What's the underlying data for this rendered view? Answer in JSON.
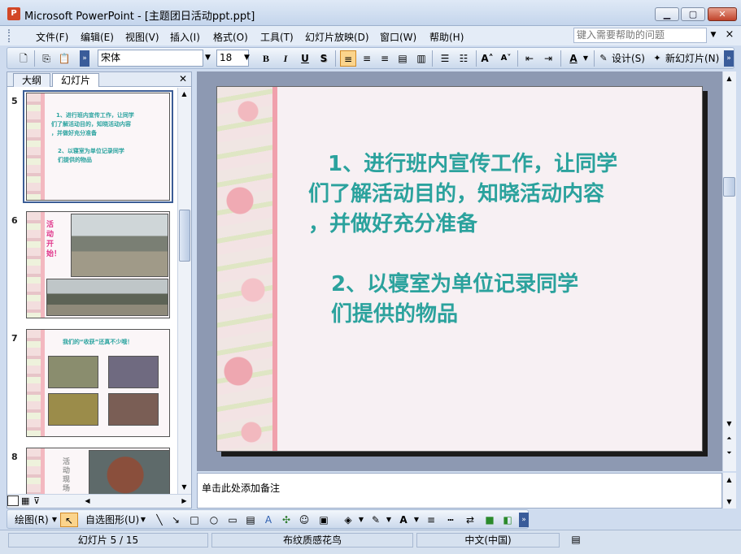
{
  "window": {
    "title": "Microsoft PowerPoint - [主题团日活动ppt.ppt]",
    "app_icon": "powerpoint-icon",
    "controls": {
      "minimize": "minimize-icon",
      "maximize": "maximize-icon",
      "close": "close-icon"
    }
  },
  "menu": {
    "items": [
      "文件(F)",
      "编辑(E)",
      "视图(V)",
      "插入(I)",
      "格式(O)",
      "工具(T)",
      "幻灯片放映(D)",
      "窗口(W)",
      "帮助(H)"
    ],
    "help_placeholder": "键入需要帮助的问题"
  },
  "toolbar": {
    "font": "宋体",
    "font_size": "18",
    "bold": "B",
    "italic": "I",
    "underline": "U",
    "shadow": "S",
    "design_label": "设计(S)",
    "new_slide_label": "新幻灯片(N)",
    "accent_color": "#fbd48c"
  },
  "left_pane": {
    "tabs": [
      "大纲",
      "幻灯片"
    ],
    "active_tab": "幻灯片",
    "slides": [
      {
        "number": "5",
        "text": [
          "1、进行班内宣传工作，让同学",
          "们了解活动目的，知晓活动内容",
          "，并做好充分准备",
          "2、以寝室为单位记录同学",
          "们提供的物品"
        ]
      },
      {
        "number": "6",
        "text": [
          "活动开始！"
        ]
      },
      {
        "number": "7",
        "text": [
          "我们的“收获”还真不少哦！"
        ]
      },
      {
        "number": "8",
        "text": [
          "活动现场"
        ]
      }
    ]
  },
  "slide": {
    "lines": [
      "1、进行班内宣传工作，让同学",
      "们了解活动目的，知晓活动内容",
      "，并做好充分准备",
      "2、以寝室为单位记录同学",
      "们提供的物品"
    ],
    "text_color": "#2ba29d"
  },
  "notes": {
    "placeholder": "单击此处添加备注"
  },
  "drawing_toolbar": {
    "draw_label": "绘图(R)",
    "autoshapes_label": "自选图形(U)"
  },
  "status": {
    "slide_position": "幻灯片 5 / 15",
    "design": "布纹质感花鸟",
    "language": "中文(中国)"
  }
}
